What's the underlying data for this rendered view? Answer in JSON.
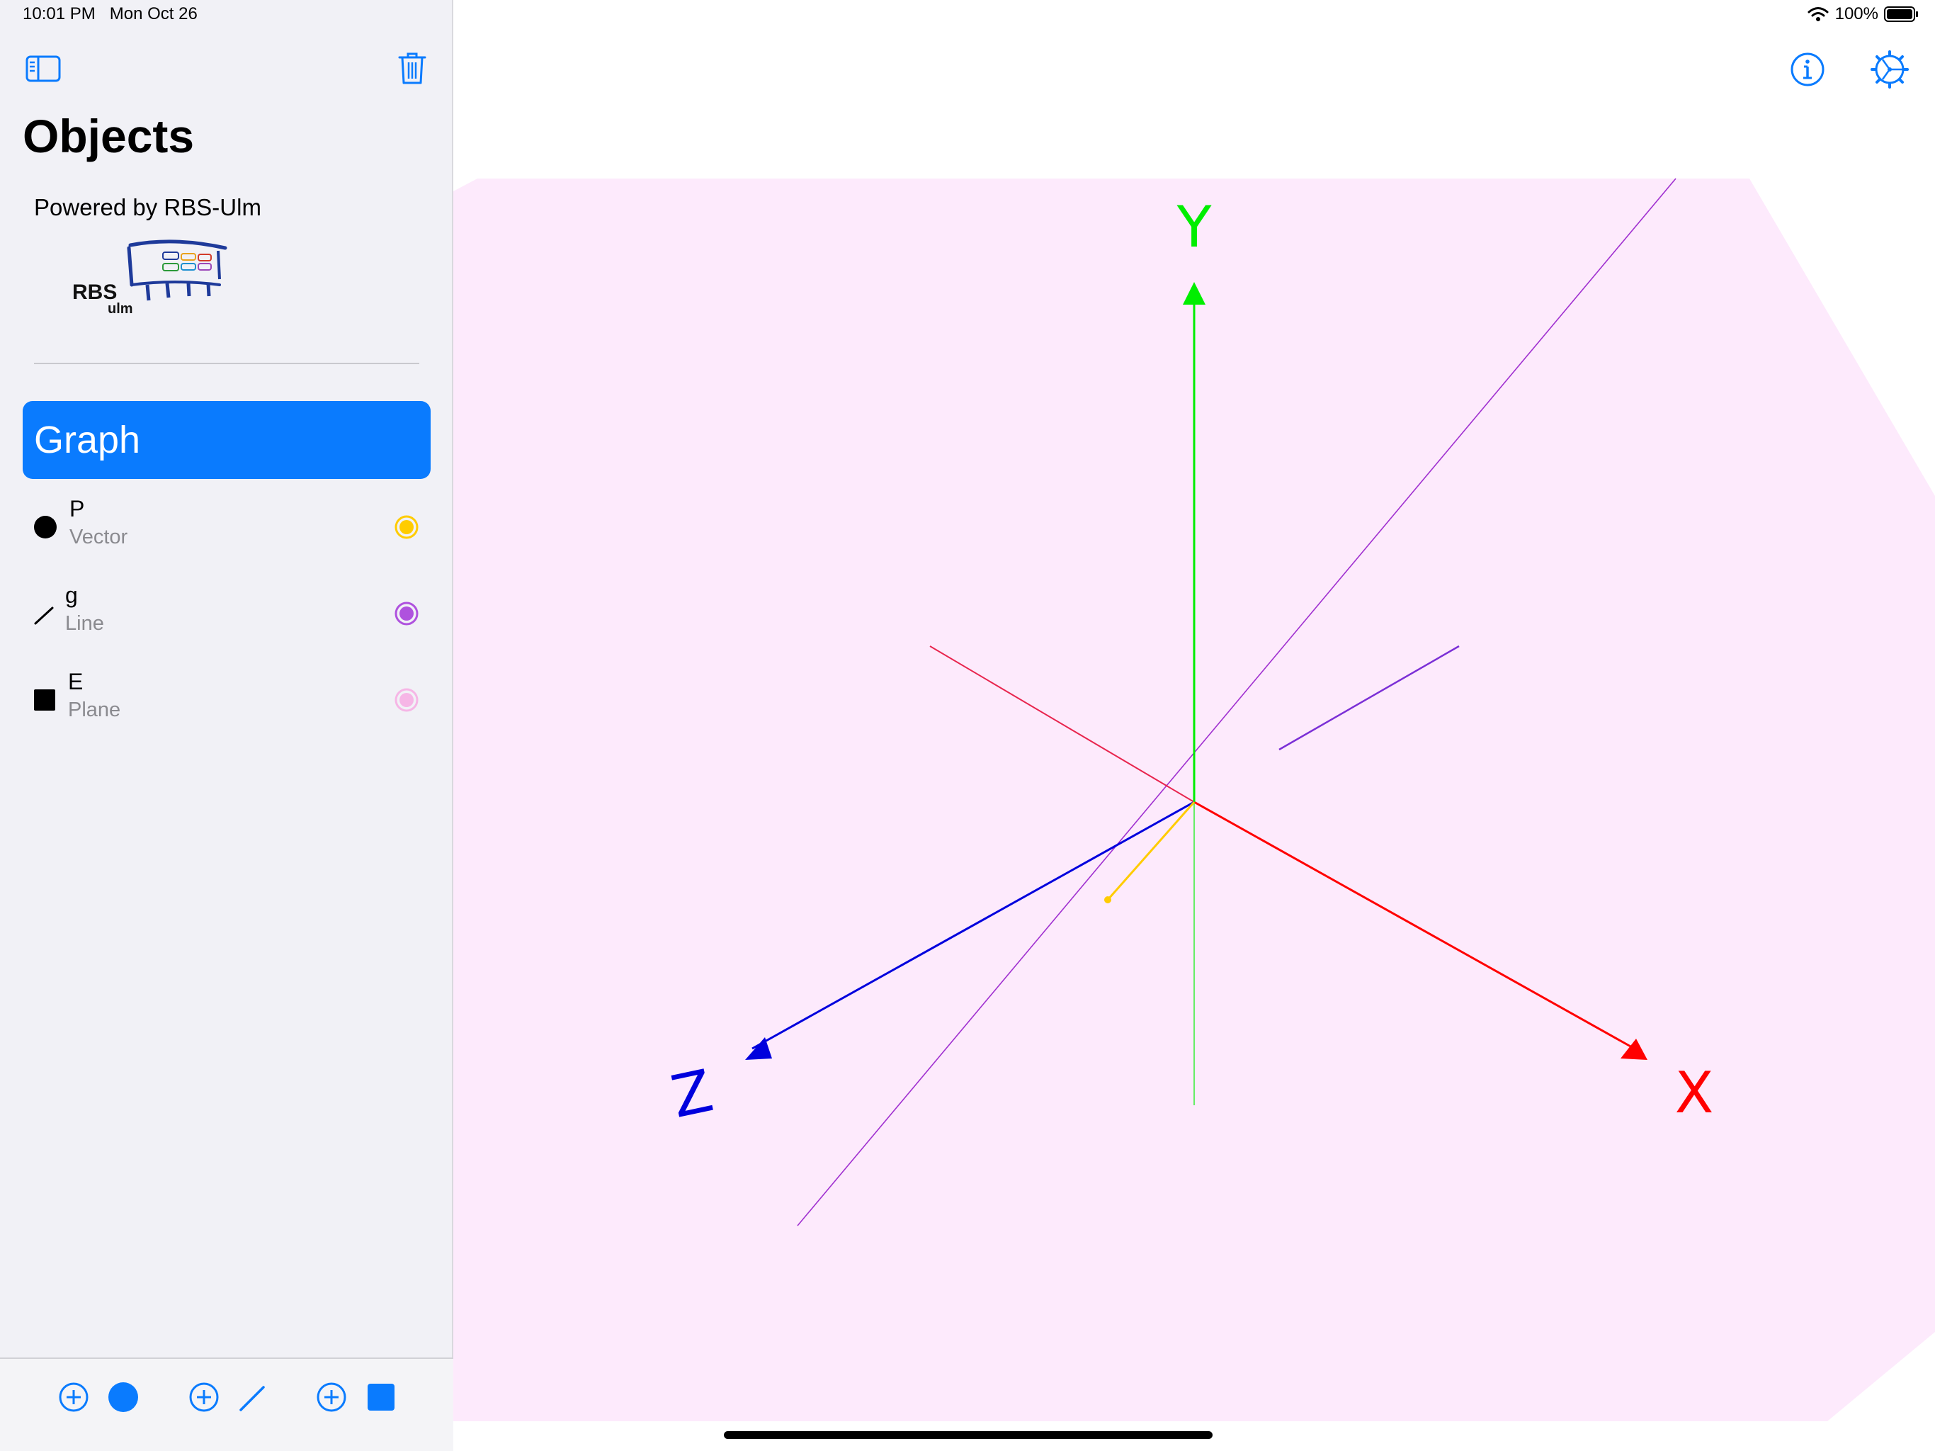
{
  "status_bar": {
    "time": "10:01 PM   Mon Oct 26",
    "battery": "100%"
  },
  "sidebar": {
    "title": "Objects",
    "powered_by": "Powered by RBS-Ulm",
    "logo": {
      "main": "RBS",
      "sub": "ulm"
    },
    "graph_label": "Graph",
    "objects": [
      {
        "name": "P",
        "type": "Vector",
        "symbol": "circle-icon",
        "color": "#ffcc00"
      },
      {
        "name": "g",
        "type": "Line",
        "symbol": "line-icon",
        "color": "#af52de"
      },
      {
        "name": "E",
        "type": "Plane",
        "symbol": "square-icon",
        "color": "#f6b6e6"
      }
    ]
  },
  "toolbar": {
    "items": [
      "add-vector",
      "add-line",
      "add-plane"
    ]
  },
  "scene": {
    "axis_labels": {
      "x": "X",
      "y": "Y",
      "z": "Z"
    },
    "colors": {
      "x_axis": "#ff0000",
      "y_axis": "#00ee00",
      "z_axis": "#0000dd",
      "vector": "#ffcc00",
      "line": "#a030d0",
      "plane": "#fdeafc",
      "accent": "#0a7bfe"
    }
  }
}
